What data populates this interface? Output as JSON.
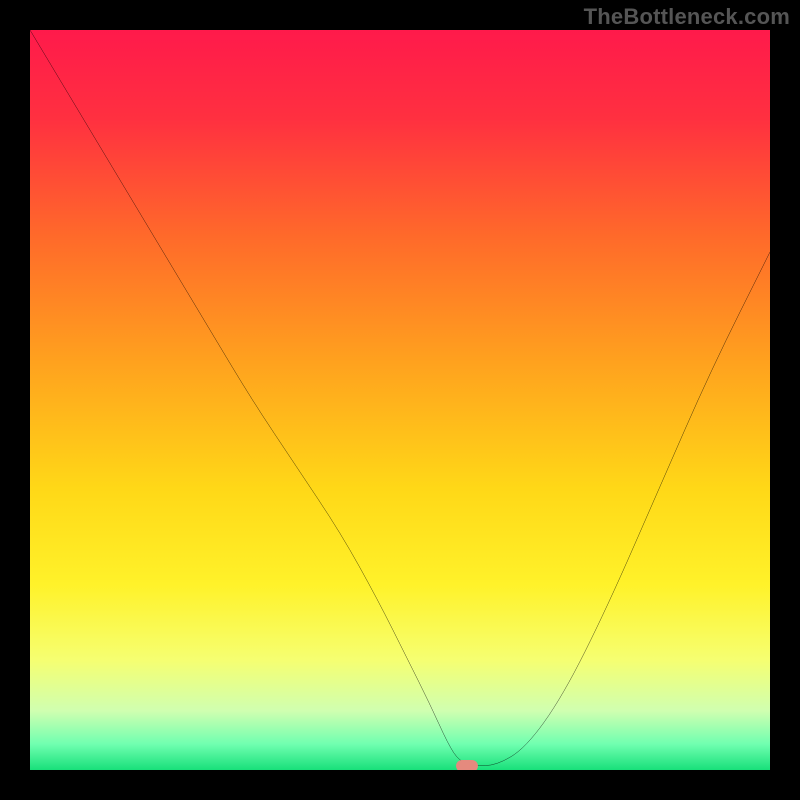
{
  "watermark": "TheBottleneck.com",
  "chart_data": {
    "type": "line",
    "title": "",
    "xlabel": "",
    "ylabel": "",
    "xlim": [
      0,
      100
    ],
    "ylim": [
      0,
      100
    ],
    "grid": false,
    "legend": false,
    "gradient_stops": [
      {
        "offset": 0.0,
        "color": "#ff1a4b"
      },
      {
        "offset": 0.12,
        "color": "#ff3040"
      },
      {
        "offset": 0.28,
        "color": "#ff6a2a"
      },
      {
        "offset": 0.45,
        "color": "#ffa21e"
      },
      {
        "offset": 0.62,
        "color": "#ffd817"
      },
      {
        "offset": 0.75,
        "color": "#fff22a"
      },
      {
        "offset": 0.85,
        "color": "#f6ff70"
      },
      {
        "offset": 0.92,
        "color": "#d0ffb0"
      },
      {
        "offset": 0.965,
        "color": "#70ffb0"
      },
      {
        "offset": 1.0,
        "color": "#18e07a"
      }
    ],
    "series": [
      {
        "name": "bottleneck-curve",
        "color": "#000000",
        "x": [
          0,
          6,
          12,
          18,
          24,
          30,
          36,
          42,
          47,
          51,
          54,
          56.5,
          58,
          60,
          63,
          67,
          72,
          78,
          85,
          92,
          100
        ],
        "y": [
          100,
          90,
          80,
          70,
          60,
          50,
          41,
          32,
          23,
          15,
          9,
          3.5,
          1.2,
          0.6,
          0.6,
          3,
          10,
          22,
          38,
          54,
          70
        ]
      }
    ],
    "marker": {
      "x": 59,
      "y": 0.6,
      "color": "#e58a7e"
    }
  }
}
